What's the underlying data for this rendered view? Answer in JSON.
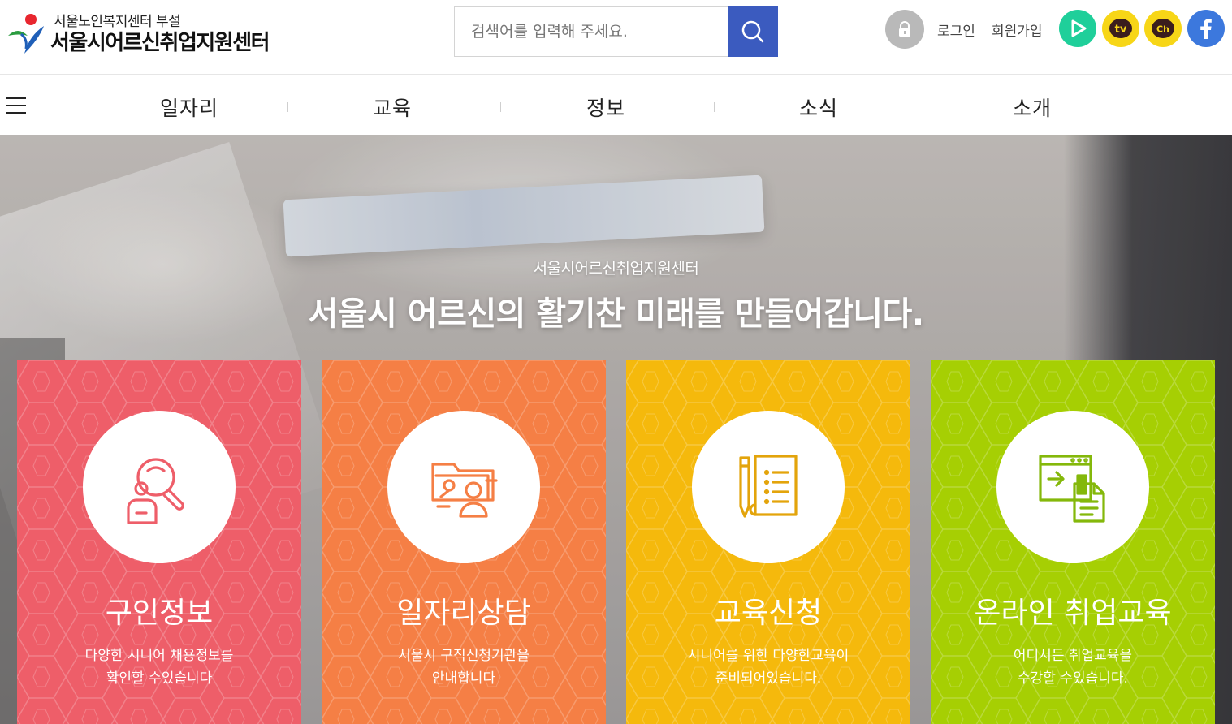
{
  "header": {
    "logo_sub": "서울노인복지센터 부설",
    "logo_main": "서울시어르신취업지원센터",
    "search_placeholder": "검색어를 입력해 주세요.",
    "login_label": "로그인",
    "join_label": "회원가입"
  },
  "gnb": {
    "items": [
      "일자리",
      "교육",
      "정보",
      "소식",
      "소개"
    ]
  },
  "hero": {
    "kicker": "서울시어르신취업지원센터",
    "title": "서울시 어르신의 활기찬 미래를 만들어갑니다."
  },
  "cards": [
    {
      "title": "구인정보",
      "desc1": "다양한 시니어 채용정보를",
      "desc2": "확인할 수있습니다",
      "color": "#ee5e69",
      "icon": "job-search-icon"
    },
    {
      "title": "일자리상담",
      "desc1": "서울시 구직신청기관을",
      "desc2": "안내합니다",
      "color": "#f57f45",
      "icon": "counseling-icon"
    },
    {
      "title": "교육신청",
      "desc1": "시니어를 위한 다양한교육이",
      "desc2": "준비되어있습니다.",
      "color": "#f5b90c",
      "icon": "education-apply-icon"
    },
    {
      "title": "온라인 취업교육",
      "desc1": "어디서든 취업교육을",
      "desc2": "수강할 수있습니다.",
      "color": "#a6cf03",
      "icon": "online-education-icon"
    }
  ],
  "colors": {
    "search_button": "#3b5bbf",
    "sns_play": "#1fcf9a",
    "sns_kakao": "#f7d617",
    "sns_facebook": "#3c78dd"
  }
}
